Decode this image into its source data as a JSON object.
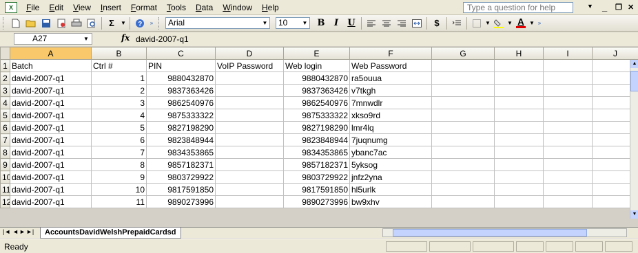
{
  "menubar": {
    "app_icon": "excel-icon",
    "items": [
      "File",
      "Edit",
      "View",
      "Insert",
      "Format",
      "Tools",
      "Data",
      "Window",
      "Help"
    ],
    "help_placeholder": "Type a question for help",
    "minimize": "_",
    "restore": "❐",
    "close": "✕"
  },
  "toolbar": {
    "font": "Arial",
    "size": "10",
    "sum": "Σ",
    "bold": "B",
    "italic": "I",
    "underline": "U",
    "currency": "$",
    "font_color_letter": "A"
  },
  "formulabar": {
    "cell_ref": "A27",
    "fx": "fx",
    "formula": "david-2007-q1"
  },
  "grid": {
    "columns": [
      "A",
      "B",
      "C",
      "D",
      "E",
      "F",
      "G",
      "H",
      "I",
      "J"
    ],
    "selected_column": "A",
    "rows": [
      {
        "n": "1",
        "cells": [
          "Batch",
          "Ctrl #",
          "PIN",
          "VoIP Password",
          "Web login",
          "Web Password"
        ]
      },
      {
        "n": "2",
        "cells": [
          "david-2007-q1",
          "1",
          "9880432870",
          "",
          "9880432870",
          "ra5ouua"
        ]
      },
      {
        "n": "3",
        "cells": [
          "david-2007-q1",
          "2",
          "9837363426",
          "",
          "9837363426",
          "v7tkgh"
        ]
      },
      {
        "n": "4",
        "cells": [
          "david-2007-q1",
          "3",
          "9862540976",
          "",
          "9862540976",
          "7mnwdlr"
        ]
      },
      {
        "n": "5",
        "cells": [
          "david-2007-q1",
          "4",
          "9875333322",
          "",
          "9875333322",
          "xkso9rd"
        ]
      },
      {
        "n": "6",
        "cells": [
          "david-2007-q1",
          "5",
          "9827198290",
          "",
          "9827198290",
          "lmr4lq"
        ]
      },
      {
        "n": "7",
        "cells": [
          "david-2007-q1",
          "6",
          "9823848944",
          "",
          "9823848944",
          "7juqnumg"
        ]
      },
      {
        "n": "8",
        "cells": [
          "david-2007-q1",
          "7",
          "9834353865",
          "",
          "9834353865",
          "ybanc7ac"
        ]
      },
      {
        "n": "9",
        "cells": [
          "david-2007-q1",
          "8",
          "9857182371",
          "",
          "9857182371",
          "5yksog"
        ]
      },
      {
        "n": "10",
        "cells": [
          "david-2007-q1",
          "9",
          "9803729922",
          "",
          "9803729922",
          "jnfz2yna"
        ]
      },
      {
        "n": "11",
        "cells": [
          "david-2007-q1",
          "10",
          "9817591850",
          "",
          "9817591850",
          "hl5urlk"
        ]
      },
      {
        "n": "12",
        "cells": [
          "david-2007-q1",
          "11",
          "9890273996",
          "",
          "9890273996",
          "bw9xhv"
        ]
      }
    ]
  },
  "sheets": {
    "active_tab": "AccountsDavidWelshPrepaidCardsd"
  },
  "status": {
    "text": "Ready"
  }
}
